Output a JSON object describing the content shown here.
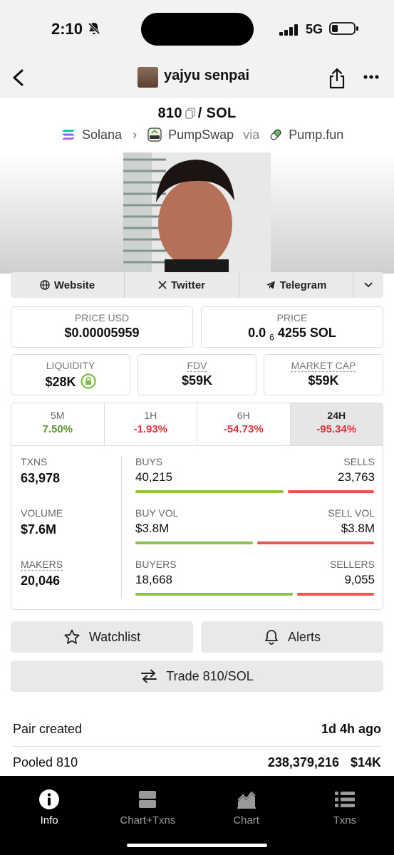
{
  "status_bar": {
    "time": "2:10",
    "network": "5G"
  },
  "header": {
    "username": "yajyu senpai"
  },
  "pair": {
    "base": "810",
    "quote": "/ SOL",
    "chain": "Solana",
    "dex": "PumpSwap",
    "via": "via",
    "launchpad": "Pump.fun"
  },
  "links": {
    "website": "Website",
    "twitter": "Twitter",
    "telegram": "Telegram"
  },
  "price_usd": {
    "label": "PRICE USD",
    "value": "$0.00005959"
  },
  "price": {
    "label": "PRICE",
    "prefix": "0.0",
    "subscript": "6",
    "suffix": "4255 SOL"
  },
  "liquidity": {
    "label": "LIQUIDITY",
    "value": "$28K"
  },
  "fdv": {
    "label": "FDV",
    "value": "$59K"
  },
  "market_cap": {
    "label": "MARKET CAP",
    "value": "$59K"
  },
  "timeframes": [
    {
      "label": "5M",
      "change": "7.50%"
    },
    {
      "label": "1H",
      "change": "-1.93%"
    },
    {
      "label": "6H",
      "change": "-54.73%"
    },
    {
      "label": "24H",
      "change": "-95.34%"
    }
  ],
  "stats": {
    "txns": {
      "label": "TXNS",
      "value": "63,978",
      "buys_label": "BUYS",
      "buys": "40,215",
      "sells_label": "SELLS",
      "sells": "23,763",
      "buy_ratio": 0.63
    },
    "volume": {
      "label": "VOLUME",
      "value": "$7.6M",
      "buys_label": "BUY VOL",
      "buys": "$3.8M",
      "sells_label": "SELL VOL",
      "sells": "$3.8M",
      "buy_ratio": 0.5
    },
    "makers": {
      "label": "MAKERS",
      "value": "20,046",
      "buys_label": "BUYERS",
      "buys": "18,668",
      "sells_label": "SELLERS",
      "sells": "9,055",
      "buy_ratio": 0.67
    }
  },
  "buttons": {
    "watchlist": "Watchlist",
    "alerts": "Alerts",
    "trade": "Trade 810/SOL"
  },
  "info_rows": {
    "pair_created_label": "Pair created",
    "pair_created_value": "1d 4h ago",
    "pooled_label": "Pooled 810",
    "pooled_amount": "238,379,216",
    "pooled_usd": "$14K"
  },
  "bottom_nav": [
    {
      "label": "Info",
      "icon": "info-icon"
    },
    {
      "label": "Chart+Txns",
      "icon": "chart-txns-icon"
    },
    {
      "label": "Chart",
      "icon": "chart-icon"
    },
    {
      "label": "Txns",
      "icon": "list-icon"
    }
  ],
  "colors": {
    "positive": "#5a9a2a",
    "negative": "#e0323e",
    "buy_bar": "#8bc34a",
    "sell_bar": "#ef5350"
  }
}
